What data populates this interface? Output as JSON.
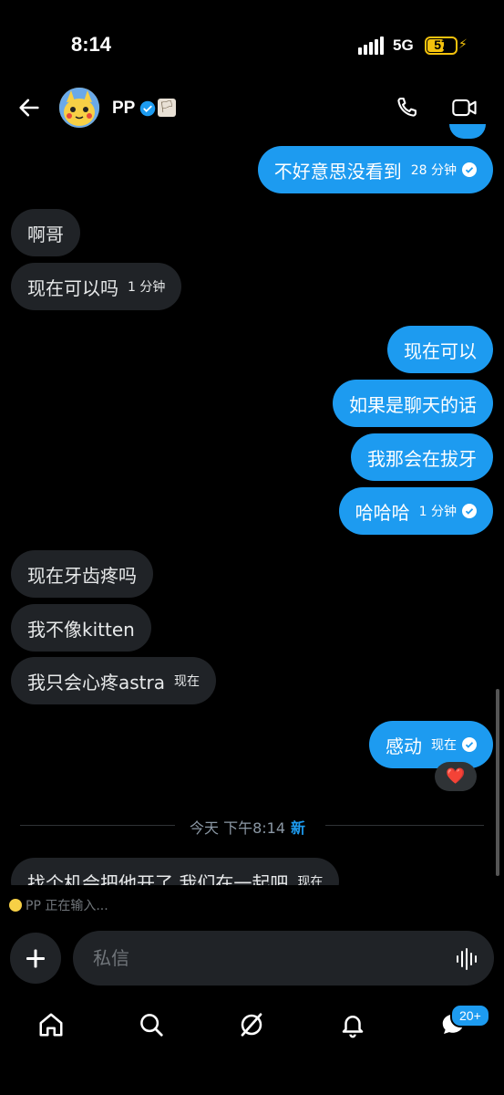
{
  "status": {
    "time": "8:14",
    "network": "5G",
    "battery": "57",
    "battery_level": 0.57
  },
  "header": {
    "name": "PP",
    "flag_emoji": "🏳"
  },
  "messages": [
    {
      "dir": "out",
      "text": "不好意思没看到",
      "time": "28 分钟",
      "read": true
    },
    {
      "dir": "in",
      "text": "啊哥"
    },
    {
      "dir": "in",
      "text": "现在可以吗",
      "time": "1 分钟"
    },
    {
      "dir": "out",
      "text": "现在可以"
    },
    {
      "dir": "out",
      "text": "如果是聊天的话"
    },
    {
      "dir": "out",
      "text": "我那会在拔牙"
    },
    {
      "dir": "out",
      "text": "哈哈哈",
      "time": "1 分钟",
      "read": true
    },
    {
      "dir": "in",
      "text": "现在牙齿疼吗"
    },
    {
      "dir": "in",
      "text": "我不像kitten"
    },
    {
      "dir": "in",
      "text": "我只会心疼astra",
      "time": "现在"
    },
    {
      "dir": "out",
      "text": "感动",
      "time": "现在",
      "read": true
    },
    {
      "dir": "in",
      "text": "找个机会把他开了 我们在一起吧",
      "time": "现在"
    }
  ],
  "reaction": "❤️",
  "divider": {
    "label": "今天 下午8:14",
    "new": "新"
  },
  "typing": "PP 正在输入...",
  "composer": {
    "placeholder": "私信"
  },
  "tabs": {
    "notifications_badge": "20+"
  }
}
